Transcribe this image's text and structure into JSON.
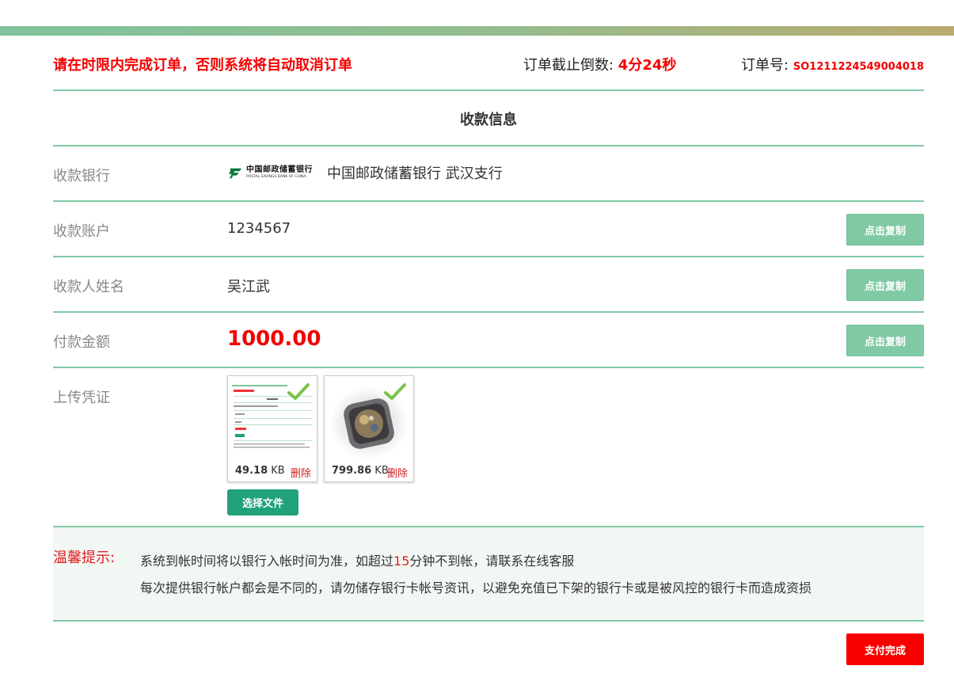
{
  "header": {
    "warning": "请在时限内完成订单，否则系统将自动取消订单",
    "countdown_label": "订单截止倒数: ",
    "countdown_value": "4分24秒",
    "order_label": "订单号: ",
    "order_value": "SO1211224549004018"
  },
  "section_title": "收款信息",
  "rows": {
    "bank": {
      "label": "收款银行",
      "logo_cn": "中国邮政储蓄银行",
      "logo_en": "POSTAL SAVINGS BANK OF CHINA",
      "value": "中国邮政储蓄银行  武汉支行"
    },
    "account": {
      "label": "收款账户",
      "value": "1234567",
      "button": "点击复制"
    },
    "name": {
      "label": "收款人姓名",
      "value": "吴江武",
      "button": "点击复制"
    },
    "amount": {
      "label": "付款金额",
      "value": "1000.00",
      "button": "点击复制"
    },
    "upload": {
      "label": "上传凭证"
    }
  },
  "uploads": [
    {
      "size": "49.18",
      "unit": " KB",
      "delete": "删除"
    },
    {
      "size": "799.86",
      "unit": " KB",
      "delete": "删除"
    }
  ],
  "choose_file": "选择文件",
  "notice": {
    "label": "温馨提示:",
    "line1_a": "系统到帐时间将以银行入帐时间为准，如超过",
    "line1_num": "15",
    "line1_b": "分钟不到帐，请联系在线客服",
    "line2": "每次提供银行帐户都会是不同的，请勿储存银行卡帐号资讯，以避免充值已下架的银行卡或是被风控的银行卡而造成资损"
  },
  "done_button": "支付完成",
  "colors": {
    "accent": "#7fcaa4",
    "danger": "#f20000",
    "primary_btn": "#21a17b"
  }
}
